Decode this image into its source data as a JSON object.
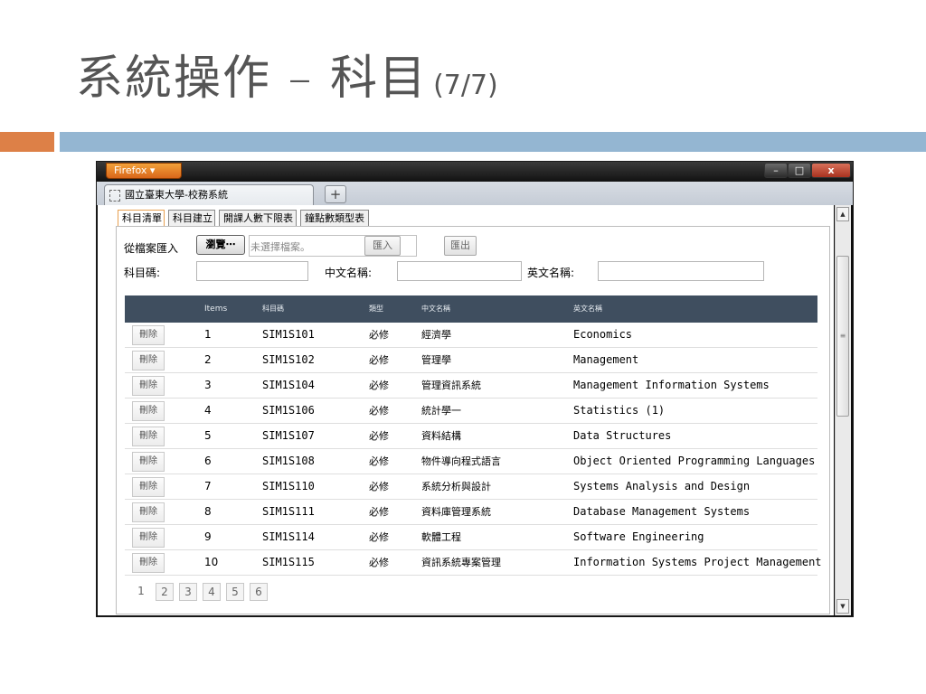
{
  "slide": {
    "title": "系統操作 – 科目",
    "page_indicator": "(7/7)"
  },
  "browser": {
    "app_button": "Firefox ▾",
    "tab_title": "國立臺東大學-校務系統",
    "new_tab": "+",
    "window_controls": {
      "minimize": "–",
      "maximize": "□",
      "close": "x"
    }
  },
  "subtabs": [
    "科目清單",
    "科目建立",
    "開課人數下限表",
    "鐘點數類型表"
  ],
  "form": {
    "import_label": "從檔案匯入",
    "browse_button": "瀏覽⋯",
    "no_file_text": "未選擇檔案。",
    "import_button": "匯入",
    "export_button": "匯出",
    "code_label": "科目碼:",
    "chinese_name_label": "中文名稱:",
    "english_name_label": "英文名稱:",
    "code_value": "",
    "chinese_name_value": "",
    "english_name_value": ""
  },
  "table": {
    "headers": [
      "Items",
      "科目碼",
      "類型",
      "中文名稱",
      "英文名稱"
    ],
    "delete_label": "刪除",
    "rows": [
      {
        "item": "1",
        "code": "SIM1S101",
        "type": "必修",
        "zh": "經濟學",
        "en": "Economics"
      },
      {
        "item": "2",
        "code": "SIM1S102",
        "type": "必修",
        "zh": "管理學",
        "en": "Management"
      },
      {
        "item": "3",
        "code": "SIM1S104",
        "type": "必修",
        "zh": "管理資訊系統",
        "en": "Management Information Systems"
      },
      {
        "item": "4",
        "code": "SIM1S106",
        "type": "必修",
        "zh": "統計學一",
        "en": "Statistics (1)"
      },
      {
        "item": "5",
        "code": "SIM1S107",
        "type": "必修",
        "zh": "資料結構",
        "en": "Data Structures"
      },
      {
        "item": "6",
        "code": "SIM1S108",
        "type": "必修",
        "zh": "物件導向程式語言",
        "en": "Object Oriented Programming Languages"
      },
      {
        "item": "7",
        "code": "SIM1S110",
        "type": "必修",
        "zh": "系統分析與設計",
        "en": "Systems Analysis and Design"
      },
      {
        "item": "8",
        "code": "SIM1S111",
        "type": "必修",
        "zh": "資料庫管理系統",
        "en": "Database Management Systems"
      },
      {
        "item": "9",
        "code": "SIM1S114",
        "type": "必修",
        "zh": "軟體工程",
        "en": "Software Engineering"
      },
      {
        "item": "10",
        "code": "SIM1S115",
        "type": "必修",
        "zh": "資訊系統專案管理",
        "en": "Information Systems Project Management"
      }
    ]
  },
  "pagination": {
    "pages": [
      "1",
      "2",
      "3",
      "4",
      "5",
      "6"
    ],
    "current": "1"
  },
  "colors": {
    "accent_orange": "#dd8047",
    "accent_blue": "#94b6d2",
    "grid_header": "#3f4e5f",
    "title_text": "#555555"
  }
}
